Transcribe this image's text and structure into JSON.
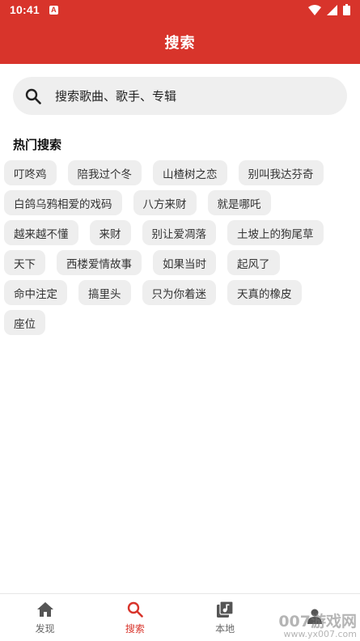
{
  "status_bar": {
    "time": "10:41",
    "notification_glyph": "A"
  },
  "app_bar": {
    "title": "搜索"
  },
  "search": {
    "placeholder": "搜索歌曲、歌手、专辑"
  },
  "hot_search": {
    "title": "热门搜索",
    "rows": [
      [
        "叮咚鸡",
        "陪我过个冬",
        "山楂树之恋",
        "别叫我达芬奇"
      ],
      [
        "白鸽乌鸦相爱的戏码",
        "八方来财",
        "就是哪吒"
      ],
      [
        "越来越不懂",
        "来财",
        "别让爱凋落",
        "土坡上的狗尾草"
      ],
      [
        "天下",
        "西楼爱情故事",
        "如果当时",
        "起风了"
      ],
      [
        "命中注定",
        "搞里头",
        "只为你着迷",
        "天真的橡皮"
      ],
      [
        "座位"
      ]
    ]
  },
  "bottom_nav": {
    "items": [
      {
        "label": "发现",
        "icon": "home-icon",
        "active": false
      },
      {
        "label": "搜索",
        "icon": "search-icon",
        "active": true
      },
      {
        "label": "本地",
        "icon": "music-library-icon",
        "active": false
      },
      {
        "label": "",
        "icon": "person-icon",
        "active": false
      }
    ]
  },
  "watermark": {
    "line1": "007游戏网",
    "line2": "www.yx007.com"
  },
  "colors": {
    "primary": "#d8342b",
    "tag_bg": "#eeeeee",
    "search_bg": "#efefef"
  }
}
